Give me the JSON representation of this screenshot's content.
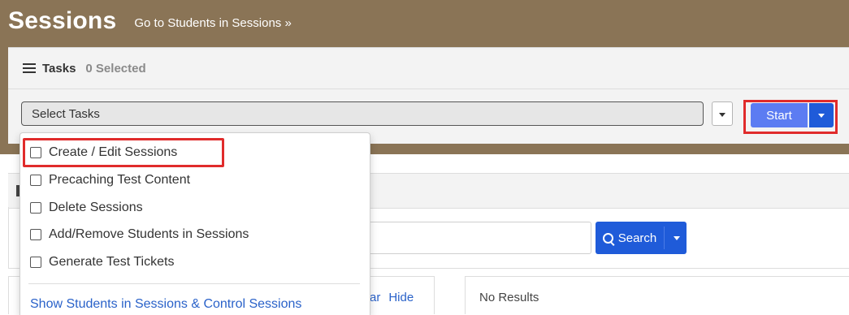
{
  "header": {
    "title": "Sessions",
    "link_label": "Go to Students in Sessions »"
  },
  "tasks": {
    "label": "Tasks",
    "selected_count": "0 Selected",
    "select_placeholder": "Select Tasks",
    "start_label": "Start"
  },
  "dropdown": {
    "options": [
      {
        "label": "Create / Edit Sessions"
      },
      {
        "label": "Precaching Test Content"
      },
      {
        "label": "Delete Sessions"
      },
      {
        "label": "Add/Remove Students in Sessions"
      },
      {
        "label": "Generate Test Tickets"
      }
    ],
    "link_label": "Show Students in Sessions & Control Sessions"
  },
  "search": {
    "button_label": "Search"
  },
  "panel": {
    "clear_partial": "ar",
    "hide_label": "Hide"
  },
  "results": {
    "empty_text": "No Results"
  },
  "colors": {
    "header_band": "#8a7456",
    "start_primary": "#5c7cf2",
    "primary_blue": "#1f5bd9",
    "highlight_red": "#e02b2b",
    "link_blue": "#2a62c9"
  }
}
